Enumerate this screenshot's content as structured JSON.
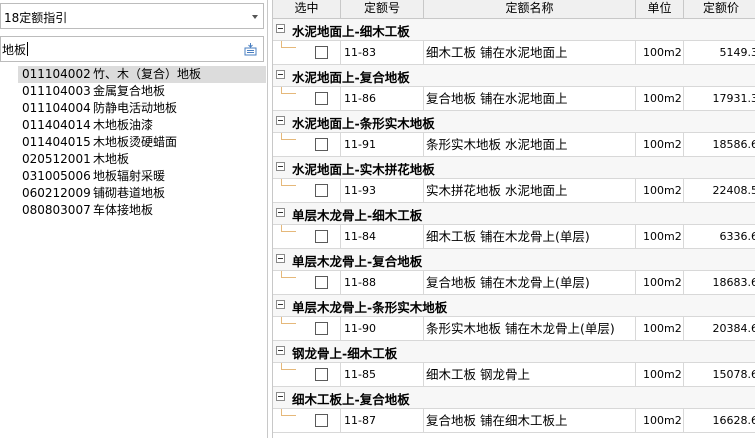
{
  "left": {
    "guide_select": {
      "value": "18定额指引"
    },
    "search": {
      "value": "地板"
    },
    "results": [
      {
        "code": "011104002",
        "name": "竹、木（复合）地板",
        "selected": true
      },
      {
        "code": "011104003",
        "name": "金属复合地板",
        "selected": false
      },
      {
        "code": "011104004",
        "name": "防静电活动地板",
        "selected": false
      },
      {
        "code": "011404014",
        "name": "木地板油漆",
        "selected": false
      },
      {
        "code": "011404015",
        "name": "木地板烫硬蜡面",
        "selected": false
      },
      {
        "code": "020512001",
        "name": "木地板",
        "selected": false
      },
      {
        "code": "031005006",
        "name": "地板辐射采暖",
        "selected": false
      },
      {
        "code": "060212009",
        "name": "铺砌巷道地板",
        "selected": false
      },
      {
        "code": "080803007",
        "name": "车体接地板",
        "selected": false
      }
    ]
  },
  "grid": {
    "headers": {
      "select": "选中",
      "code": "定额号",
      "name": "定额名称",
      "unit": "单位",
      "price": "定额价"
    },
    "groups": [
      {
        "title": "水泥地面上-细木工板",
        "code": "11-83",
        "name": "细木工板 铺在水泥地面上",
        "unit": "100m2",
        "price": "5149.3"
      },
      {
        "title": "水泥地面上-复合地板",
        "code": "11-86",
        "name": "复合地板 铺在水泥地面上",
        "unit": "100m2",
        "price": "17931.3"
      },
      {
        "title": "水泥地面上-条形实木地板",
        "code": "11-91",
        "name": "条形实木地板 水泥地面上",
        "unit": "100m2",
        "price": "18586.6"
      },
      {
        "title": "水泥地面上-实木拼花地板",
        "code": "11-93",
        "name": "实木拼花地板 水泥地面上",
        "unit": "100m2",
        "price": "22408.5"
      },
      {
        "title": "单层木龙骨上-细木工板",
        "code": "11-84",
        "name": "细木工板 铺在木龙骨上(单层)",
        "unit": "100m2",
        "price": "6336.6"
      },
      {
        "title": "单层木龙骨上-复合地板",
        "code": "11-88",
        "name": "复合地板 铺在木龙骨上(单层)",
        "unit": "100m2",
        "price": "18683.6"
      },
      {
        "title": "单层木龙骨上-条形实木地板",
        "code": "11-90",
        "name": "条形实木地板 铺在木龙骨上(单层)",
        "unit": "100m2",
        "price": "20384.6"
      },
      {
        "title": "钢龙骨上-细木工板",
        "code": "11-85",
        "name": "细木工板 钢龙骨上",
        "unit": "100m2",
        "price": "15078.6"
      },
      {
        "title": "细木工板上-复合地板",
        "code": "11-87",
        "name": "复合地板 铺在细木工板上",
        "unit": "100m2",
        "price": "16628.6"
      }
    ]
  },
  "icons": {
    "search_button": "search-list-icon",
    "dropdown": "chevron-down-icon",
    "expander": "collapse-minus-icon"
  }
}
